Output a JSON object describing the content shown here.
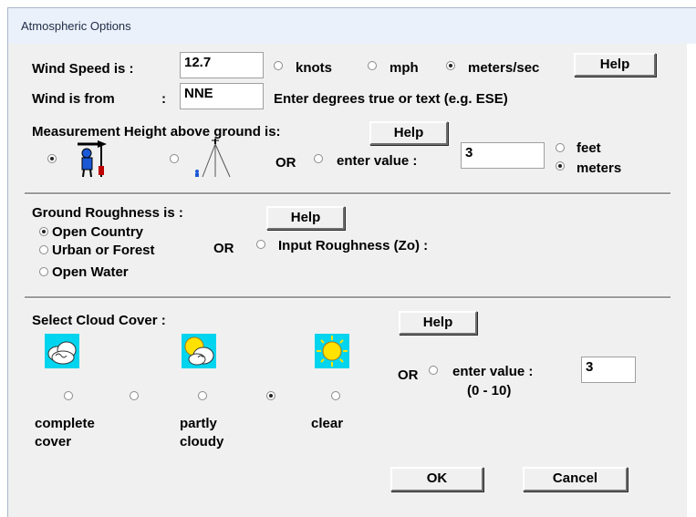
{
  "window": {
    "title": "Atmospheric Options"
  },
  "wind": {
    "speed_label": "Wind Speed is :",
    "speed_value": "12.7",
    "unit_knots": "knots",
    "unit_mph": "mph",
    "unit_mps": "meters/sec",
    "selected_unit": "meters/sec",
    "help_label": "Help",
    "from_label": "Wind is from",
    "from_colon": ":",
    "from_value": "NNE",
    "from_hint": "Enter degrees true or text (e.g. ESE)"
  },
  "height": {
    "label": "Measurement Height above ground is:",
    "help_label": "Help",
    "or_label": "OR",
    "enter_value_label": "enter value :",
    "value": "3",
    "unit_feet": "feet",
    "unit_meters": "meters",
    "selected_unit": "meters",
    "icons": [
      "person-with-wind-vane-icon",
      "tower-icon"
    ]
  },
  "roughness": {
    "label": "Ground Roughness is :",
    "help_label": "Help",
    "options": [
      "Open Country",
      "Urban or Forest",
      "Open Water"
    ],
    "selected": "Open Country",
    "or_label": "OR",
    "input_label": "Input Roughness (Zo) :"
  },
  "cloud": {
    "label": "Select Cloud Cover :",
    "help_label": "Help",
    "icons": [
      "cloud-icon",
      "sun-behind-cloud-icon",
      "sun-icon"
    ],
    "selected_index": 3,
    "caption_complete_1": "complete",
    "caption_complete_2": "cover",
    "caption_partly_1": "partly",
    "caption_partly_2": "cloudy",
    "caption_clear": "clear",
    "or_label": "OR",
    "enter_value_label": "enter value :",
    "value": "3",
    "range": "(0 - 10)"
  },
  "footer": {
    "ok_label": "OK",
    "cancel_label": "Cancel"
  },
  "colors": {
    "dialog_bg": "#f0f0f0",
    "title_bg": "#ebf1fa",
    "sky": "#00d4ee",
    "sun": "#ffe200"
  }
}
